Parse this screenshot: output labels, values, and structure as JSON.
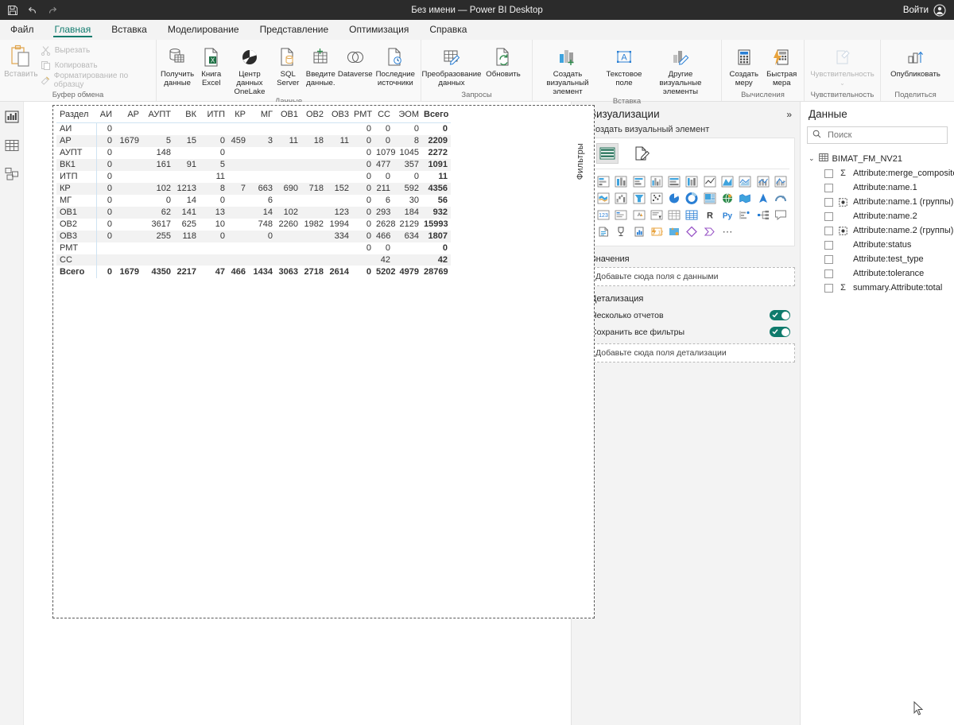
{
  "titlebar": {
    "title": "Без имени — Power BI Desktop",
    "signin": "Войти",
    "qat": [
      "save-icon",
      "undo-icon",
      "redo-icon"
    ]
  },
  "menubar": {
    "items": [
      {
        "label": "Файл",
        "active": false
      },
      {
        "label": "Главная",
        "active": true
      },
      {
        "label": "Вставка",
        "active": false
      },
      {
        "label": "Моделирование",
        "active": false
      },
      {
        "label": "Представление",
        "active": false
      },
      {
        "label": "Оптимизация",
        "active": false
      },
      {
        "label": "Справка",
        "active": false
      }
    ]
  },
  "ribbon": {
    "clipboard": {
      "group_label": "Буфер обмена",
      "paste": "Вставить",
      "cut": "Вырезать",
      "copy": "Копировать",
      "format_painter": "Форматирование по образцу"
    },
    "data": {
      "group_label": "Данные",
      "get_data": "Получить данные",
      "excel": "Книга Excel",
      "onelake": "Центр данных OneLake",
      "sql": "SQL Server",
      "enter_data": "Введите данные.",
      "dataverse": "Dataverse",
      "recent": "Последние источники"
    },
    "queries": {
      "group_label": "Запросы",
      "transform": "Преобразование данных",
      "refresh": "Обновить"
    },
    "insert": {
      "group_label": "Вставка",
      "new_visual": "Создать визуальный элемент",
      "text_box": "Текстовое поле",
      "more_visuals": "Другие визуальные элементы"
    },
    "calculations": {
      "group_label": "Вычисления",
      "new_measure": "Создать меру",
      "quick_measure": "Быстрая мера"
    },
    "sensitivity": {
      "group_label": "Чувствительность",
      "sensitivity": "Чувствительность"
    },
    "share": {
      "group_label": "Поделиться",
      "publish": "Опубликовать"
    }
  },
  "leftrail": {
    "items": [
      {
        "name": "report-view-icon",
        "selected": true
      },
      {
        "name": "data-table-view-icon",
        "selected": false
      },
      {
        "name": "model-view-icon",
        "selected": false
      }
    ]
  },
  "chart_data": {
    "type": "table",
    "title": "",
    "columns": [
      "Раздел",
      "АИ",
      "АР",
      "АУПТ",
      "ВК",
      "ИТП",
      "КР",
      "МГ",
      "ОВ1",
      "ОВ2",
      "ОВ3",
      "РМТ",
      "СС",
      "ЭОМ",
      "Всего"
    ],
    "rows": [
      {
        "label": "АИ",
        "values": [
          "0",
          "",
          "",
          "",
          "",
          "",
          "",
          "",
          "",
          "",
          "0",
          "0",
          "0",
          "0"
        ]
      },
      {
        "label": "АР",
        "values": [
          "0",
          "1679",
          "5",
          "15",
          "0",
          "459",
          "3",
          "11",
          "18",
          "11",
          "0",
          "0",
          "8",
          "2209"
        ]
      },
      {
        "label": "АУПТ",
        "values": [
          "0",
          "",
          "148",
          "",
          "0",
          "",
          "",
          "",
          "",
          "",
          "0",
          "1079",
          "1045",
          "2272"
        ]
      },
      {
        "label": "ВК1",
        "values": [
          "0",
          "",
          "161",
          "91",
          "5",
          "",
          "",
          "",
          "",
          "",
          "0",
          "477",
          "357",
          "1091"
        ]
      },
      {
        "label": "ИТП",
        "values": [
          "0",
          "",
          "",
          "",
          "11",
          "",
          "",
          "",
          "",
          "",
          "0",
          "0",
          "0",
          "11"
        ]
      },
      {
        "label": "КР",
        "values": [
          "0",
          "",
          "102",
          "1213",
          "8",
          "7",
          "663",
          "690",
          "718",
          "152",
          "0",
          "211",
          "592",
          "4356"
        ]
      },
      {
        "label": "МГ",
        "values": [
          "0",
          "",
          "0",
          "14",
          "0",
          "",
          "6",
          "",
          "",
          "",
          "0",
          "6",
          "30",
          "56"
        ]
      },
      {
        "label": "ОВ1",
        "values": [
          "0",
          "",
          "62",
          "141",
          "13",
          "",
          "14",
          "102",
          "",
          "123",
          "0",
          "293",
          "184",
          "932"
        ]
      },
      {
        "label": "ОВ2",
        "values": [
          "0",
          "",
          "3617",
          "625",
          "10",
          "",
          "748",
          "2260",
          "1982",
          "1994",
          "0",
          "2628",
          "2129",
          "15993"
        ]
      },
      {
        "label": "ОВ3",
        "values": [
          "0",
          "",
          "255",
          "118",
          "0",
          "",
          "0",
          "",
          "",
          "334",
          "0",
          "466",
          "634",
          "1807"
        ]
      },
      {
        "label": "РМТ",
        "values": [
          "",
          "",
          "",
          "",
          "",
          "",
          "",
          "",
          "",
          "",
          "0",
          "0",
          "",
          "0"
        ]
      },
      {
        "label": "СС",
        "values": [
          "",
          "",
          "",
          "",
          "",
          "",
          "",
          "",
          "",
          "",
          "",
          "42",
          "",
          "42"
        ]
      }
    ],
    "total_row": {
      "label": "Всего",
      "values": [
        "0",
        "1679",
        "4350",
        "2217",
        "47",
        "466",
        "1434",
        "3063",
        "2718",
        "2614",
        "0",
        "5202",
        "4979",
        "28769"
      ]
    }
  },
  "visualizations": {
    "title": "Визуализации",
    "filters_tab": "Фильтры",
    "build_label": "Создать визуальный элемент",
    "collapse_icon": "chevron-double-left-icon",
    "expand_icon": "chevron-double-right-icon",
    "gallery_tabs": [
      {
        "name": "build-visual-icon",
        "selected": true
      },
      {
        "name": "format-visual-icon",
        "selected": false
      }
    ],
    "icons": [
      "stacked-bar-chart-icon",
      "stacked-column-chart-icon",
      "clustered-bar-chart-icon",
      "clustered-column-chart-icon",
      "100-stacked-bar-chart-icon",
      "100-stacked-column-chart-icon",
      "line-chart-icon",
      "area-chart-icon",
      "stacked-area-chart-icon",
      "line-stacked-column-chart-icon",
      "line-clustered-column-chart-icon",
      "ribbon-chart-icon",
      "waterfall-chart-icon",
      "funnel-chart-icon",
      "scatter-chart-icon",
      "pie-chart-icon",
      "donut-chart-icon",
      "treemap-icon",
      "map-icon",
      "filled-map-icon",
      "azure-map-icon",
      "arc-gis-map-icon",
      "card-icon",
      "multi-row-card-icon",
      "kpi-icon",
      "slicer-icon",
      "table-icon",
      "matrix-icon",
      "r-script-visual-icon",
      "python-visual-icon",
      "key-influencers-icon",
      "decomposition-tree-icon",
      "qa-visual-icon",
      "paginated-report-icon",
      "narrative-icon",
      "metrics-icon",
      "smart-narrative-icon",
      "azure-ml-icon",
      "power-apps-icon",
      "power-automate-icon",
      "more-options-icon"
    ],
    "wells": {
      "values_label": "Значения",
      "values_placeholder": "Добавьте сюда поля с данными",
      "drillthrough_label": "Детализация",
      "cross_report": "Несколько отчетов",
      "keep_filters": "Сохранить все фильтры",
      "drillthrough_placeholder": "Добавьте сюда поля детализации",
      "cross_report_on": true,
      "keep_filters_on": true
    }
  },
  "data_pane": {
    "title": "Данные",
    "search_placeholder": "Поиск",
    "search_value": "",
    "table_name": "BIMAT_FM_NV21",
    "fields": [
      {
        "label": "Attribute:merge_composites",
        "icon": "sigma-icon"
      },
      {
        "label": "Attribute:name.1",
        "icon": ""
      },
      {
        "label": "Attribute:name.1 (группы)",
        "icon": "group-icon"
      },
      {
        "label": "Attribute:name.2",
        "icon": ""
      },
      {
        "label": "Attribute:name.2 (группы)",
        "icon": "group-icon"
      },
      {
        "label": "Attribute:status",
        "icon": ""
      },
      {
        "label": "Attribute:test_type",
        "icon": ""
      },
      {
        "label": "Attribute:tolerance",
        "icon": ""
      },
      {
        "label": "summary.Attribute:total",
        "icon": "sigma-icon"
      }
    ]
  },
  "colors": {
    "accent": "#0f7b6c",
    "titlebar_bg": "#2b2b2b",
    "pane_bg": "#f3f3f3",
    "grid_line": "#cfe3f2"
  }
}
